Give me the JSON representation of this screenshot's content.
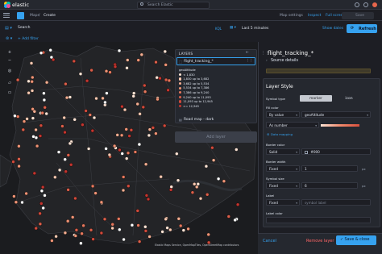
{
  "header": {
    "brand": "elastic",
    "search_placeholder": "Search Elastic"
  },
  "breadcrumbs": {
    "items": [
      "Maps",
      "Create"
    ],
    "separator": "/"
  },
  "top_nav": {
    "map_settings": "Map settings",
    "inspect": "Inspect",
    "full_screen": "Full screen",
    "save": "Save"
  },
  "query": {
    "placeholder": "Search",
    "language": "KQL",
    "time_range": "Last 5 minutes",
    "show_dates": "Show dates",
    "refresh": "Refresh"
  },
  "filter": {
    "add_filter": "+ Add filter"
  },
  "layers_panel": {
    "title": "LAYERS",
    "layers": [
      {
        "name": "flight_tracking_*",
        "icon": "layer-points-icon"
      },
      {
        "name": "Road map - dark",
        "icon": "layer-tiles-icon"
      }
    ],
    "legend": {
      "field": "geoAltitude",
      "rows": [
        {
          "label": "< 1,830",
          "color": "#fce3d4"
        },
        {
          "label": "1,830 up to 3,682",
          "color": "#f9c9b1"
        },
        {
          "label": "3,682 up to 5,534",
          "color": "#f4ae91"
        },
        {
          "label": "5,534 up to 7,386",
          "color": "#ef9375"
        },
        {
          "label": "7,386 up to 9,240",
          "color": "#e6785d"
        },
        {
          "label": "9,240 up to 11,093",
          "color": "#dc5f4a"
        },
        {
          "label": "11,093 up to 12,945",
          "color": "#d14a3b"
        },
        {
          "label": ">= 12,945",
          "color": "#c4352f"
        }
      ]
    },
    "add_layer": "Add layer"
  },
  "map": {
    "attribution": "Elastic Maps Service, OpenMapTiles, OpenStreetMap contributors"
  },
  "editor": {
    "layer_name": "flight_tracking_*",
    "source_details": "Source details",
    "section_title": "Layer Style",
    "symbol_type": {
      "label": "Symbol type",
      "options": [
        "marker",
        "icon"
      ],
      "selected": "marker"
    },
    "fill_color": {
      "label": "Fill color",
      "mode": "By value",
      "field": "geoAltitude",
      "as": "As number",
      "data_mapping": "Data mapping"
    },
    "border_color": {
      "label": "Border color",
      "mode": "Solid",
      "value": "#000"
    },
    "border_width": {
      "label": "Border width",
      "mode": "Fixed",
      "value": "1",
      "unit": "px"
    },
    "symbol_size": {
      "label": "Symbol size",
      "mode": "Fixed",
      "value": "6",
      "unit": "px"
    },
    "label": {
      "label": "Label",
      "mode": "Fixed",
      "placeholder": "symbol label"
    },
    "label_color": {
      "label": "Label color"
    }
  },
  "footer": {
    "cancel": "Cancel",
    "remove_layer": "Remove layer",
    "save_close": "Save & close"
  },
  "colors": {
    "accent": "#36a2ef",
    "danger": "#ff6666",
    "marker_light": "#fce3d4",
    "marker_dark": "#c4352f"
  }
}
